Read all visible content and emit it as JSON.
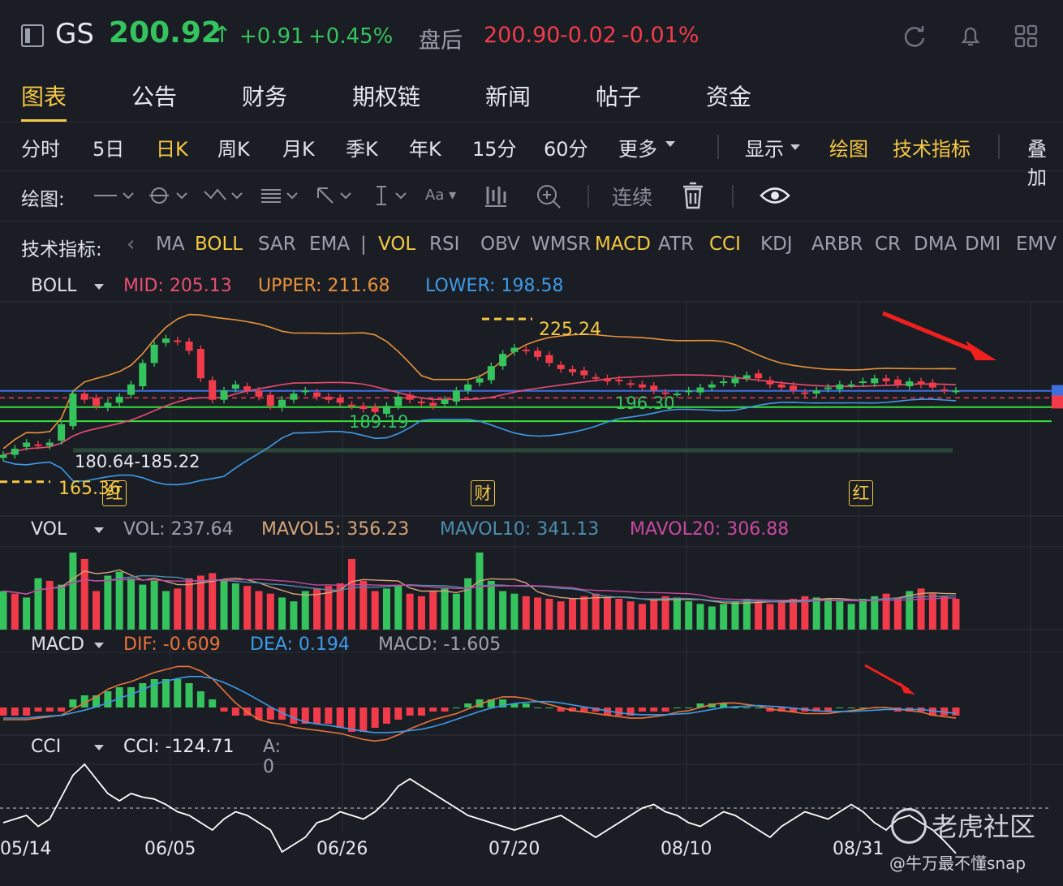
{
  "header": {
    "symbol": "GS",
    "price": "200.92",
    "change": "+0.91",
    "change_pct": "+0.45%",
    "afterhours_label": "盘后",
    "ah_price": "200.90",
    "ah_change": "-0.02",
    "ah_pct": "-0.01%",
    "icons": [
      "refresh-icon",
      "bell-icon",
      "grid-icon"
    ]
  },
  "tabs": [
    "图表",
    "公告",
    "财务",
    "期权链",
    "新闻",
    "帖子",
    "资金"
  ],
  "periods": [
    "分时",
    "5日",
    "日K",
    "周K",
    "月K",
    "季K",
    "年K",
    "15分",
    "60分",
    "更多"
  ],
  "period_right": [
    "显示",
    "绘图",
    "技术指标",
    "叠加"
  ],
  "drawbar": {
    "label": "绘图:",
    "continuous": "连续"
  },
  "indicators": {
    "label": "技术指标:",
    "items": [
      "MA",
      "BOLL",
      "SAR",
      "EMA",
      "|",
      "VOL",
      "RSI",
      "OBV",
      "WMSR",
      "MACD",
      "ATR",
      "CCI",
      "KDJ",
      "ARBR",
      "CR",
      "DMA",
      "DMI",
      "EMV"
    ]
  },
  "boll": {
    "name": "BOLL",
    "mid": "MID: 205.13",
    "upper": "UPPER: 211.68",
    "lower": "LOWER: 198.58"
  },
  "vol": {
    "name": "VOL",
    "vol": "VOL: 237.64",
    "mavol5": "MAVOL5: 356.23",
    "mavol10": "MAVOL10: 341.13",
    "mavol20": "MAVOL20: 306.88"
  },
  "macd": {
    "name": "MACD",
    "dif": "DIF: -0.609",
    "dea": "DEA: 0.194",
    "macd": "MACD: -1.605"
  },
  "cci": {
    "name": "CCI",
    "cci": "CCI: -124.71",
    "a": "A: 0"
  },
  "annotations": {
    "high": "225.24",
    "low_left": "165.36",
    "range": "180.64-185.22",
    "mid_low": "189.19",
    "right_low": "196.30",
    "markers": [
      "红",
      "财",
      "红"
    ]
  },
  "xaxis": [
    "05/14",
    "06/05",
    "06/26",
    "07/20",
    "08/10",
    "08/31"
  ],
  "watermark": {
    "brand": "老虎社区",
    "user": "@牛万最不懂snap"
  },
  "colors": {
    "up": "#35c35d",
    "down": "#f23b4a",
    "accent": "#f5c842",
    "bg": "#1b1d24"
  },
  "chart_data": {
    "type": "candlestick",
    "closes": [
      180,
      182,
      184,
      183,
      184,
      190,
      200,
      198,
      196,
      197,
      199,
      203,
      210,
      216,
      218,
      217,
      214,
      205,
      198,
      201,
      203,
      201,
      199,
      196,
      198,
      200,
      201,
      199,
      198,
      197,
      196,
      195,
      194,
      196,
      199,
      198,
      197,
      196,
      198,
      201,
      203,
      205,
      209,
      213,
      215,
      214,
      212,
      210,
      208,
      207,
      206,
      205,
      204,
      204,
      203,
      202,
      201,
      200,
      200,
      201,
      202,
      203,
      204,
      205,
      206,
      205,
      203,
      202,
      201,
      200,
      201,
      202,
      203,
      203,
      204,
      205,
      204,
      203,
      204,
      203,
      202,
      201,
      201
    ],
    "volume": [
      30,
      28,
      25,
      40,
      38,
      35,
      60,
      55,
      30,
      42,
      45,
      40,
      35,
      38,
      30,
      32,
      40,
      42,
      44,
      38,
      36,
      34,
      30,
      28,
      25,
      22,
      30,
      32,
      34,
      36,
      55,
      38,
      30,
      32,
      34,
      28,
      26,
      30,
      32,
      28,
      40,
      60,
      38,
      30,
      28,
      26,
      25,
      24,
      22,
      24,
      26,
      28,
      25,
      24,
      22,
      20,
      24,
      26,
      25,
      22,
      20,
      18,
      20,
      22,
      24,
      22,
      20,
      22,
      24,
      26,
      25,
      24,
      22,
      20,
      24,
      26,
      28,
      25,
      30,
      32,
      28,
      26,
      24
    ],
    "vol_up": [
      1,
      0,
      1,
      1,
      0,
      1,
      1,
      0,
      0,
      1,
      1,
      1,
      1,
      1,
      1,
      0,
      0,
      0,
      0,
      1,
      1,
      0,
      0,
      0,
      1,
      1,
      1,
      0,
      0,
      0,
      0,
      0,
      0,
      1,
      1,
      0,
      0,
      0,
      1,
      1,
      1,
      1,
      1,
      1,
      1,
      0,
      0,
      0,
      0,
      0,
      0,
      0,
      0,
      0,
      0,
      0,
      0,
      0,
      1,
      1,
      1,
      1,
      1,
      1,
      1,
      0,
      0,
      0,
      0,
      0,
      1,
      1,
      1,
      1,
      1,
      1,
      0,
      0,
      1,
      0,
      0,
      0,
      0
    ],
    "macd_hist": [
      -2,
      -2,
      -2,
      -1,
      -1,
      -1,
      2,
      3,
      3,
      4,
      5,
      5,
      6,
      7,
      7,
      7,
      6,
      4,
      2,
      -1,
      -2,
      -2,
      -3,
      -3,
      -3,
      -4,
      -4,
      -4,
      -4,
      -5,
      -6,
      -6,
      -5,
      -4,
      -3,
      -2,
      -2,
      -1,
      -1,
      0,
      1,
      2,
      2,
      2,
      1,
      1,
      0,
      0,
      -1,
      -1,
      -1,
      -1,
      -2,
      -2,
      -2,
      -1,
      -1,
      -1,
      0,
      0,
      1,
      1,
      1,
      0,
      0,
      0,
      -1,
      -1,
      -1,
      -1,
      -1,
      -1,
      0,
      0,
      0,
      0,
      0,
      -1,
      -1,
      -1,
      -2,
      -2,
      -2
    ],
    "cci": [
      -40,
      -30,
      -20,
      -50,
      -30,
      30,
      90,
      120,
      80,
      40,
      20,
      40,
      30,
      25,
      10,
      -10,
      -20,
      -40,
      -60,
      -30,
      -10,
      -20,
      -40,
      -60,
      -120,
      -100,
      -80,
      -40,
      -30,
      -10,
      -20,
      -30,
      -10,
      20,
      60,
      80,
      60,
      40,
      20,
      0,
      -20,
      -30,
      -40,
      -50,
      -60,
      -50,
      -40,
      -30,
      -20,
      -40,
      -60,
      -80,
      -60,
      -40,
      -20,
      0,
      10,
      -10,
      -20,
      -40,
      -50,
      -30,
      -10,
      -20,
      -40,
      -60,
      -80,
      -50,
      -30,
      -10,
      -20,
      -30,
      -10,
      10,
      -10,
      -40,
      -60,
      -30,
      -20,
      -40,
      -60,
      -90,
      -124
    ]
  }
}
